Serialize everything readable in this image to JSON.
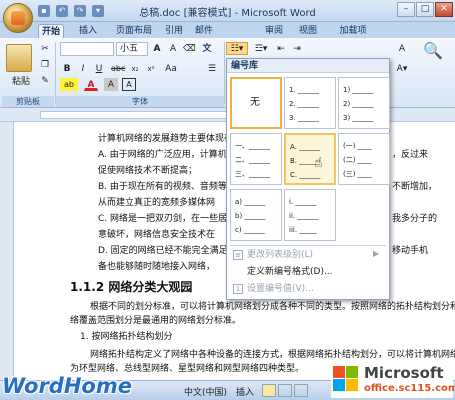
{
  "titlebar": {
    "title": "总稿.doc [兼容模式] - Microsoft Word",
    "qat_icons": [
      "save-icon",
      "undo-icon",
      "redo-icon",
      "customize-icon"
    ]
  },
  "tabs": [
    {
      "label": "开始",
      "active": true
    },
    {
      "label": "插入"
    },
    {
      "label": "页面布局"
    },
    {
      "label": "引用"
    },
    {
      "label": "邮件"
    },
    {
      "label": "审阅"
    },
    {
      "label": "视图"
    },
    {
      "label": "加载项"
    }
  ],
  "ribbon": {
    "paste_label": "粘贴",
    "font_size": "小五",
    "clipboard_group": "剪贴板",
    "font_group": "字体",
    "bold": "B",
    "italic": "I",
    "underline": "U",
    "font_color": "A",
    "char_a": "A",
    "wen": "文",
    "az": "Aa",
    "highlight": "ab"
  },
  "gallery": {
    "header": "编号库",
    "none_label": "无",
    "cells": [
      {
        "lines": [
          "无"
        ]
      },
      {
        "lines": [
          "1. ______",
          "2. ______",
          "3. ______"
        ]
      },
      {
        "lines": [
          "1) ______",
          "2) ______",
          "3) ______"
        ]
      },
      {
        "lines": [
          "一、______",
          "二、______",
          "三、______"
        ]
      },
      {
        "lines": [
          "A. ______",
          "B. ______",
          "C. ______"
        ]
      },
      {
        "lines": [
          "(一) ____",
          "(二) ____",
          "(三) ____"
        ]
      },
      {
        "lines": [
          "a) ______",
          "b) ______",
          "c) ______"
        ]
      },
      {
        "lines": [
          "i. ______",
          "ii. ______",
          "iii. _____"
        ]
      }
    ],
    "menu": [
      "更改列表级别(L)",
      "定义新编号格式(D)...",
      "设置编号值(V)..."
    ]
  },
  "document": {
    "lines": [
      "计算机网络的发展趋势主要体现在",
      "A. 由于网络的广泛应用，计算机",
      "    促使网络技术不断提高；",
      "B. 由于现在所有的视频、音频等",
      "    从而建立真正的宽频多媒体网",
      "C. 网络是一把双刃剑，在一些居",
      "    意破坏，网络信息安全技术在",
      "D. 固定的网络已经不能完全满足",
      "    备也能够随时随地接入网络，",
      "1.1.2 网络分类大观园",
      "根据不同的划分标准，可以将计算机网络划分成各种不同的类型。按照网络的拓扑结构划分和按",
      "络覆盖范围划分是最通用的网络划分标准。",
      "1. 按网络拓扑结构划分",
      "网络拓扑结构定义了网络中各种设备的连接方式，根据网络拓扑结构划分，可以将计算机网络划分",
      "为环型网络、总线型网络、星型网络和网型网络四种类型。"
    ],
    "right_frags": [
      "，反过来",
      "不断增加，",
      "我多分子的",
      "移动手机"
    ]
  },
  "status": {
    "language": "中文(中国)",
    "insert": "插入"
  },
  "watermarks": {
    "wordhome": "WordHome",
    "ms_line1": "Microsoft",
    "ms_line2": "office.sc115.com"
  },
  "colors": {
    "ribbon_bg": "#dbe7f6",
    "accent": "#f0b040",
    "ms_red": "#f25022",
    "ms_green": "#7fba00",
    "ms_blue": "#00a4ef",
    "ms_yellow": "#ffb900"
  }
}
